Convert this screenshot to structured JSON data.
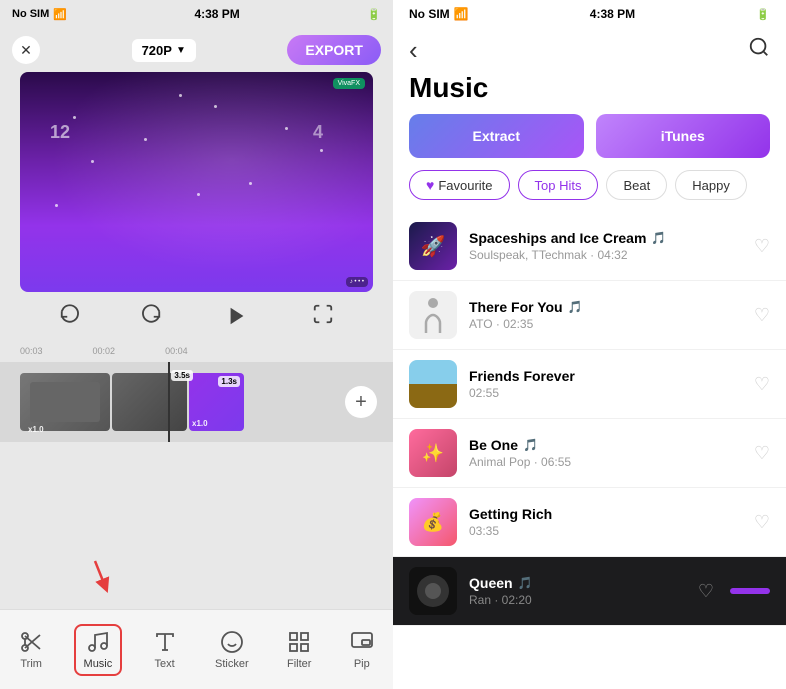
{
  "left": {
    "status": {
      "carrier": "No SIM",
      "time": "4:38 PM",
      "battery_low": true
    },
    "close_label": "✕",
    "resolution": "720P",
    "export_label": "EXPORT",
    "timecodes": [
      "00:03",
      "00:02",
      "00:04"
    ],
    "clips": [
      {
        "label": "3.5s",
        "x": "x1.0",
        "type": "car"
      },
      {
        "label": "1.3s",
        "x": "x1.0",
        "type": "purple"
      }
    ],
    "tools": [
      {
        "id": "trim",
        "label": "Trim",
        "icon": "✂"
      },
      {
        "id": "music",
        "label": "Music",
        "icon": "♪",
        "active": true
      },
      {
        "id": "text",
        "label": "Text",
        "icon": "T"
      },
      {
        "id": "sticker",
        "label": "Sticker",
        "icon": "☺"
      },
      {
        "id": "filter",
        "label": "Filter",
        "icon": "⊞"
      },
      {
        "id": "pip",
        "label": "Pip",
        "icon": "▣"
      }
    ]
  },
  "right": {
    "status": {
      "carrier": "No SIM",
      "time": "4:38 PM"
    },
    "back_label": "‹",
    "title": "Music",
    "source_tabs": [
      {
        "id": "extract",
        "label": "Extract"
      },
      {
        "id": "itunes",
        "label": "iTunes"
      }
    ],
    "filter_tabs": [
      {
        "id": "favourite",
        "label": "Favourite",
        "active": false,
        "has_heart": true
      },
      {
        "id": "top-hits",
        "label": "Top Hits",
        "active": true
      },
      {
        "id": "beat",
        "label": "Beat",
        "active": false
      },
      {
        "id": "happy",
        "label": "Happy",
        "active": false
      }
    ],
    "songs": [
      {
        "id": 1,
        "title": "Spaceships and Ice Cream",
        "meta": "Soulspeak, TTechmak · 04:32",
        "thumb_type": "space",
        "pro": true,
        "active": false
      },
      {
        "id": 2,
        "title": "There For You",
        "meta": "ATO · 02:35",
        "thumb_type": "figure",
        "pro": true,
        "active": false
      },
      {
        "id": 3,
        "title": "Friends Forever",
        "meta": "02:55",
        "thumb_type": "road",
        "pro": false,
        "active": false
      },
      {
        "id": 4,
        "title": "Be One",
        "meta": "Animal Pop · 06:55",
        "thumb_type": "abstract",
        "pro": true,
        "active": false
      },
      {
        "id": 5,
        "title": "Getting Rich",
        "meta": "03:35",
        "thumb_type": "rich",
        "pro": false,
        "active": false
      },
      {
        "id": 6,
        "title": "Queen",
        "meta": "Ran · 02:20",
        "thumb_type": "dark",
        "pro": true,
        "active": true
      }
    ]
  }
}
